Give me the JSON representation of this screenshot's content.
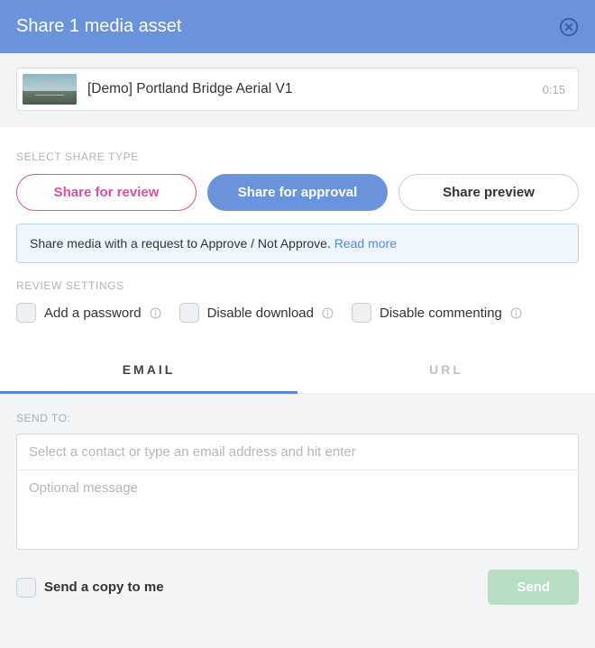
{
  "header": {
    "title": "Share 1 media asset"
  },
  "asset": {
    "name": "[Demo] Portland Bridge Aerial V1",
    "duration": "0:15"
  },
  "share_type": {
    "label": "SELECT SHARE TYPE",
    "review": "Share for review",
    "approval": "Share for approval",
    "preview": "Share preview",
    "info_text": "Share media with a request to Approve / Not Approve. ",
    "info_link": "Read more"
  },
  "review_settings": {
    "label": "REVIEW SETTINGS",
    "password": "Add a password",
    "disable_download": "Disable download",
    "disable_commenting": "Disable commenting"
  },
  "tabs": {
    "email": "EMAIL",
    "url": "URL"
  },
  "email_panel": {
    "send_to_label": "SEND TO:",
    "contact_placeholder": "Select a contact or type an email address and hit enter",
    "message_placeholder": "Optional message",
    "copy_me": "Send a copy to me",
    "send": "Send"
  }
}
